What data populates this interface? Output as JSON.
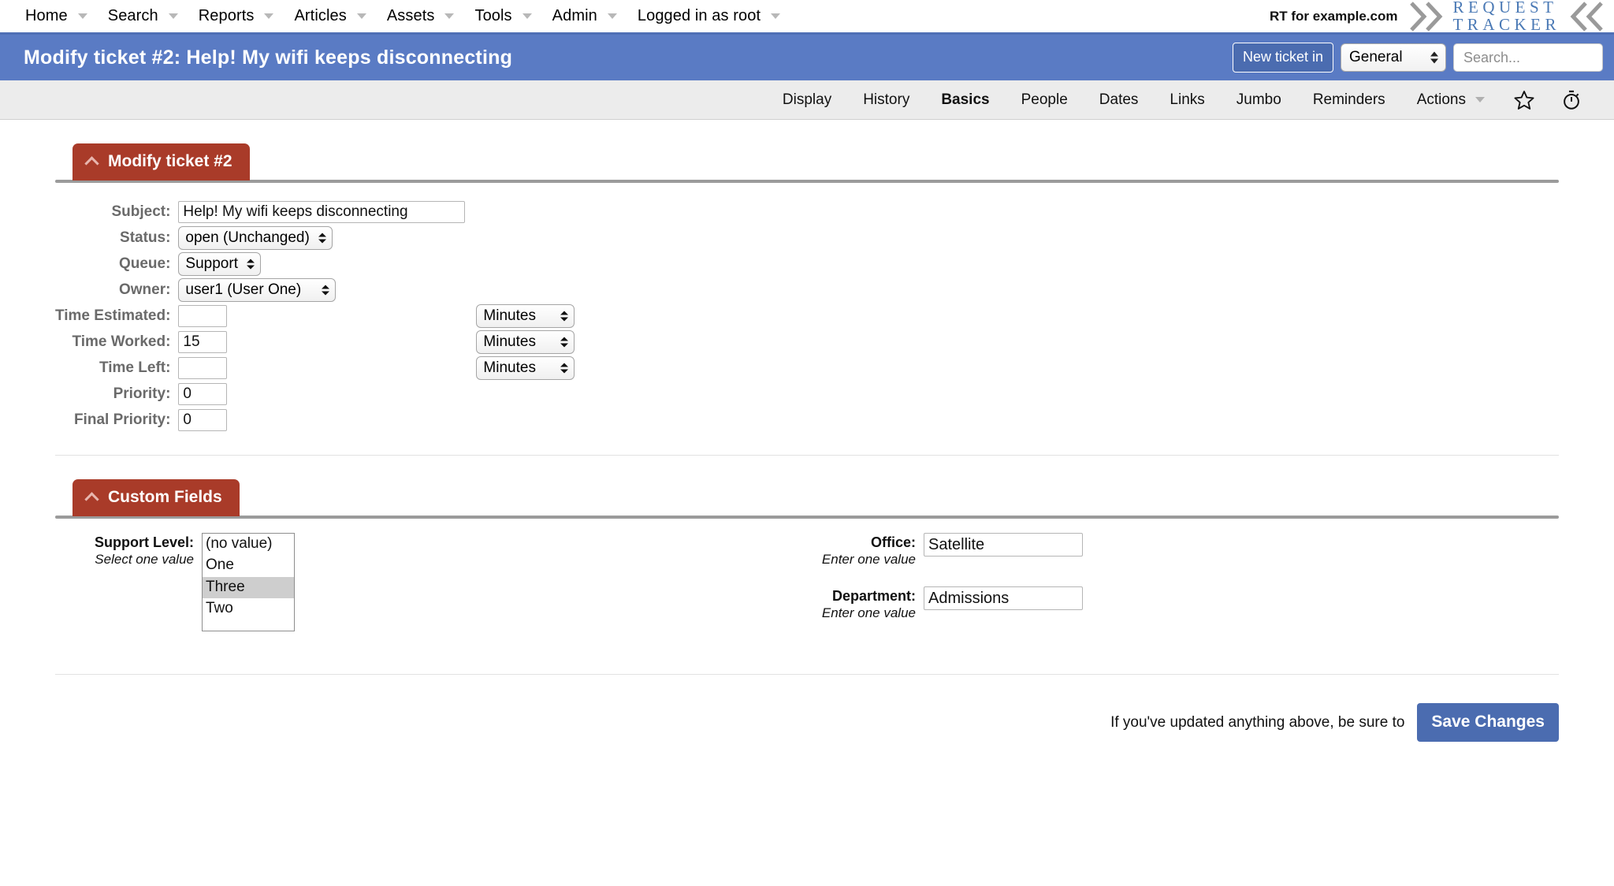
{
  "topnav": {
    "items": [
      {
        "label": "Home",
        "has_caret": true
      },
      {
        "label": "Search",
        "has_caret": true
      },
      {
        "label": "Reports",
        "has_caret": true
      },
      {
        "label": "Articles",
        "has_caret": true
      },
      {
        "label": "Assets",
        "has_caret": true
      },
      {
        "label": "Tools",
        "has_caret": true
      },
      {
        "label": "Admin",
        "has_caret": true
      },
      {
        "label": "Logged in as root",
        "has_caret": true
      }
    ],
    "instance_label": "RT for example.com",
    "logo": {
      "line1": "REQUEST",
      "line2": "TRACKER",
      "left_icon": "double-chevron-right-icon",
      "right_icon": "double-chevron-left-icon",
      "text_color": "#4a79b5",
      "chevron_color": "#9a9a9a"
    }
  },
  "titlebar": {
    "title": "Modify ticket #2: Help! My wifi keeps disconnecting",
    "background": "#5a7bc4",
    "new_ticket_label": "New ticket in",
    "queue_selected": "General",
    "search_placeholder": "Search...",
    "search_value": ""
  },
  "pagemenu": {
    "items": [
      {
        "label": "Display",
        "active": false,
        "has_caret": false
      },
      {
        "label": "History",
        "active": false,
        "has_caret": false
      },
      {
        "label": "Basics",
        "active": true,
        "has_caret": false
      },
      {
        "label": "People",
        "active": false,
        "has_caret": false
      },
      {
        "label": "Dates",
        "active": false,
        "has_caret": false
      },
      {
        "label": "Links",
        "active": false,
        "has_caret": false
      },
      {
        "label": "Jumbo",
        "active": false,
        "has_caret": false
      },
      {
        "label": "Reminders",
        "active": false,
        "has_caret": false
      },
      {
        "label": "Actions",
        "active": false,
        "has_caret": true
      }
    ],
    "icons": [
      {
        "name": "star-icon"
      },
      {
        "name": "stopwatch-timer-icon"
      }
    ]
  },
  "basics": {
    "header": "Modify ticket #2",
    "header_color": "#a93b29",
    "collapse_icon": "chevron-up-icon",
    "fields": {
      "subject_label": "Subject:",
      "subject_value": "Help! My wifi keeps disconnecting",
      "status_label": "Status:",
      "status_value": "open (Unchanged)",
      "queue_label": "Queue:",
      "queue_value": "Support",
      "owner_label": "Owner:",
      "owner_value": "user1 (User One)",
      "time_estimated_label": "Time Estimated:",
      "time_estimated_value": "",
      "time_estimated_unit": "Minutes",
      "time_worked_label": "Time Worked:",
      "time_worked_value": "15",
      "time_worked_unit": "Minutes",
      "time_left_label": "Time Left:",
      "time_left_value": "",
      "time_left_unit": "Minutes",
      "priority_label": "Priority:",
      "priority_value": "0",
      "final_priority_label": "Final Priority:",
      "final_priority_value": "0"
    }
  },
  "custom_fields": {
    "header": "Custom Fields",
    "header_color": "#a93b29",
    "collapse_icon": "chevron-up-icon",
    "support_level": {
      "label": "Support Level:",
      "hint": "Select one value",
      "options": [
        "(no value)",
        "One",
        "Three",
        "Two"
      ],
      "selected": "Three"
    },
    "office": {
      "label": "Office:",
      "hint": "Enter one value",
      "value": "Satellite"
    },
    "department": {
      "label": "Department:",
      "hint": "Enter one value",
      "value": "Admissions"
    }
  },
  "footer": {
    "note": "If you've updated anything above, be sure to",
    "save_label": "Save Changes",
    "save_color": "#4b6cb0"
  }
}
